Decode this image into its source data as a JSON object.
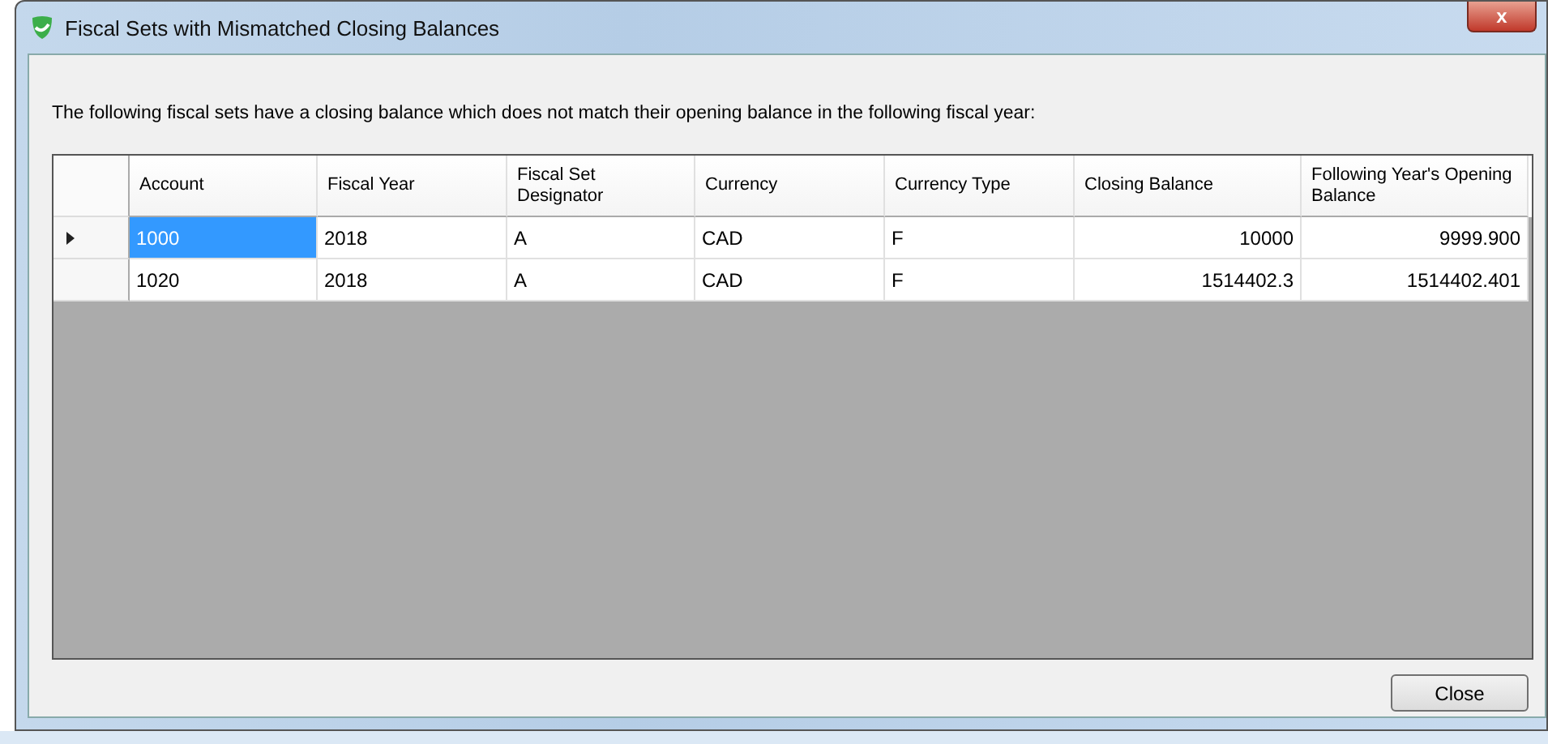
{
  "window": {
    "title": "Fiscal Sets with Mismatched Closing Balances",
    "close_glyph": "x"
  },
  "message": "The following fiscal sets have a closing balance which does not match their opening balance in the following fiscal year:",
  "table": {
    "columns": [
      {
        "label": "Account",
        "kind": "text"
      },
      {
        "label": "Fiscal Year",
        "kind": "text"
      },
      {
        "label": "Fiscal Set Designator",
        "kind": "text"
      },
      {
        "label": "Currency",
        "kind": "text"
      },
      {
        "label": "Currency Type",
        "kind": "text"
      },
      {
        "label": "Closing Balance",
        "kind": "number"
      },
      {
        "label": "Following Year's Opening Balance",
        "kind": "number"
      }
    ],
    "rows": [
      {
        "selected": true,
        "cells": [
          "1000",
          "2018",
          "A",
          "CAD",
          "F",
          "10000",
          "9999.900"
        ]
      },
      {
        "selected": false,
        "cells": [
          "1020",
          "2018",
          "A",
          "CAD",
          "F",
          "1514402.3",
          "1514402.401"
        ]
      }
    ]
  },
  "buttons": [
    {
      "label": "Close"
    }
  ]
}
